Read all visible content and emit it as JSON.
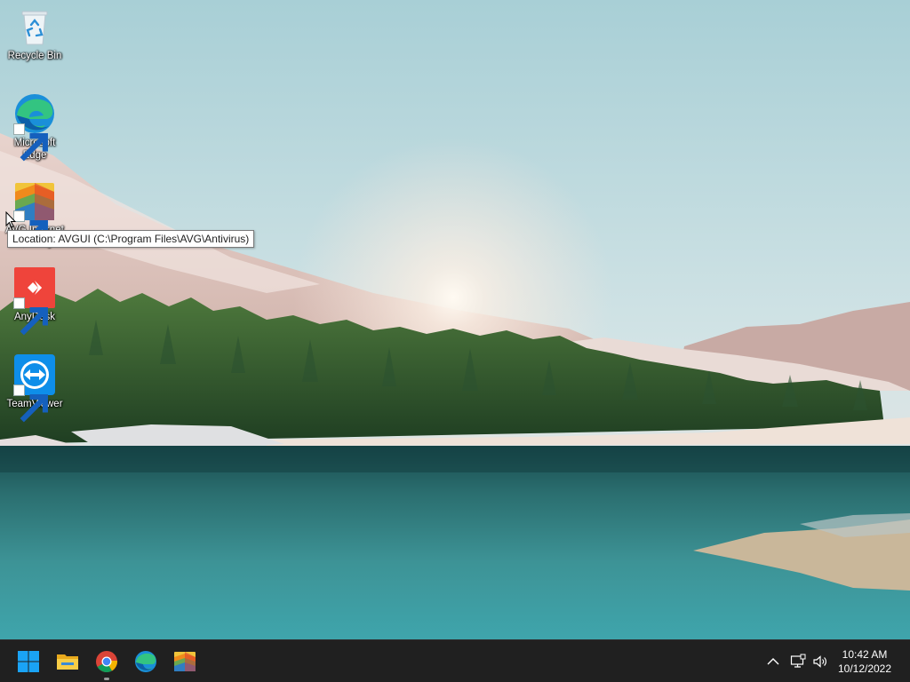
{
  "desktop": {
    "icons": [
      {
        "name": "recycle-bin",
        "label": "Recycle Bin",
        "shortcut": false
      },
      {
        "name": "microsoft-edge",
        "label": "Microsoft Edge",
        "shortcut": true
      },
      {
        "name": "avg-internet-security",
        "label": "AVG Internet Security",
        "shortcut": true
      },
      {
        "name": "anydesk",
        "label": "AnyDesk",
        "shortcut": true
      },
      {
        "name": "teamviewer",
        "label": "TeamViewer",
        "shortcut": true
      }
    ],
    "tooltip": "Location: AVGUI (C:\\Program Files\\AVG\\Antivirus)"
  },
  "taskbar": {
    "pinned": [
      {
        "name": "start",
        "icon": "windows-logo-icon"
      },
      {
        "name": "file-explorer",
        "icon": "folder-icon"
      },
      {
        "name": "google-chrome",
        "icon": "chrome-icon",
        "running": true
      },
      {
        "name": "microsoft-edge",
        "icon": "edge-icon"
      },
      {
        "name": "avg",
        "icon": "avg-icon"
      }
    ],
    "tray": {
      "icons": [
        "chevron-up-icon",
        "network-icon",
        "volume-icon"
      ],
      "time": "10:42 AM",
      "date": "10/12/2022"
    }
  },
  "colors": {
    "taskbar_bg": "#202020",
    "windows_blue": "#1aa3f5",
    "anydesk_red": "#ef443b",
    "teamviewer_blue": "#0e8ee9"
  }
}
